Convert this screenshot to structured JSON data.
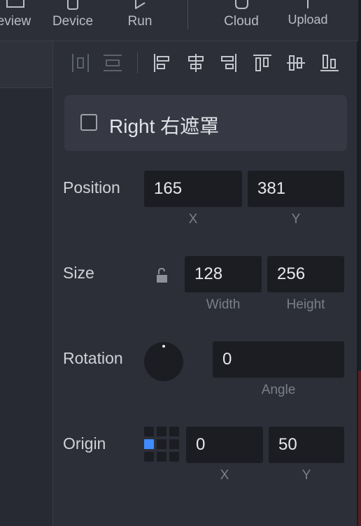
{
  "toolbar": {
    "buttons": [
      {
        "label": "eview",
        "icon": "preview-icon"
      },
      {
        "label": "Device",
        "icon": "device-icon"
      },
      {
        "label": "Run",
        "icon": "play-icon"
      },
      {
        "label": "Cloud",
        "icon": "cloud-icon"
      },
      {
        "label": "Upload",
        "icon": "upload-icon"
      }
    ]
  },
  "align_tools": [
    "distribute-horizontal-icon",
    "distribute-vertical-icon",
    "align-left-icon",
    "align-center-horizontal-icon",
    "align-right-icon",
    "align-top-icon",
    "align-center-vertical-icon",
    "align-bottom-icon"
  ],
  "layer": {
    "name": "Right 右遮罩",
    "checked": false
  },
  "position": {
    "label": "Position",
    "x": "165",
    "y": "381",
    "x_label": "X",
    "y_label": "Y"
  },
  "size": {
    "label": "Size",
    "width": "128",
    "height": "256",
    "width_label": "Width",
    "height_label": "Height",
    "locked": false
  },
  "rotation": {
    "label": "Rotation",
    "angle": "0",
    "angle_label": "Angle"
  },
  "origin": {
    "label": "Origin",
    "x": "0",
    "y": "50",
    "x_label": "X",
    "y_label": "Y",
    "active_anchor": "middle-left"
  },
  "colors": {
    "accent": "#3f8cff",
    "panel_bg": "#2c2f38",
    "field_bg": "#1b1d22"
  }
}
